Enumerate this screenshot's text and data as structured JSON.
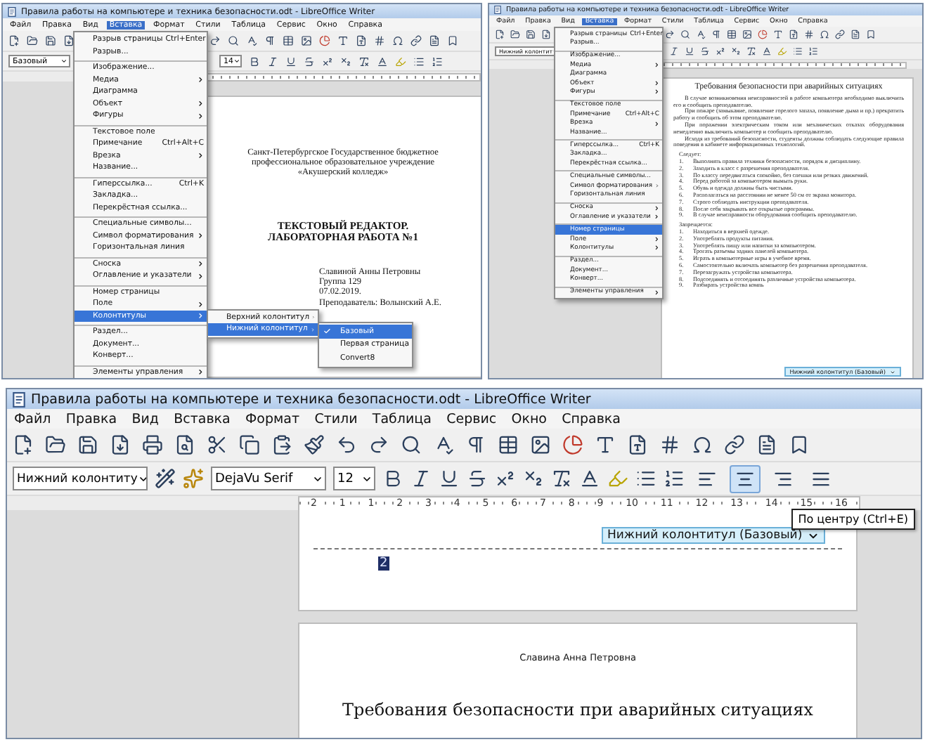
{
  "top_left": {
    "title": "Правила работы на компьютере и техника безопасности.odt - LibreOffice Writer",
    "menu": [
      {
        "label": "Файл",
        "selected": false
      },
      {
        "label": "Правка",
        "selected": false
      },
      {
        "label": "Вид",
        "selected": false
      },
      {
        "label": "Вставка",
        "selected": true
      },
      {
        "label": "Формат",
        "selected": false
      },
      {
        "label": "Стили",
        "selected": false
      },
      {
        "label": "Таблица",
        "selected": false
      },
      {
        "label": "Сервис",
        "selected": false
      },
      {
        "label": "Окно",
        "selected": false
      },
      {
        "label": "Справка",
        "selected": false
      }
    ],
    "style_box": "Базовый",
    "size_box": "14",
    "insert_menu": [
      {
        "label": "Разрыв страницы",
        "shortcut": "Ctrl+Enter",
        "submenu": false,
        "separator_before": false,
        "selected": false
      },
      {
        "label": "Разрыв...",
        "submenu": false,
        "separator_before": false,
        "selected": false
      },
      {
        "label": "Изображение...",
        "submenu": false,
        "separator_before": true,
        "selected": false
      },
      {
        "label": "Медиа",
        "submenu": true,
        "separator_before": false,
        "selected": false
      },
      {
        "label": "Диаграмма",
        "submenu": false,
        "separator_before": false,
        "selected": false
      },
      {
        "label": "Объект",
        "submenu": true,
        "separator_before": false,
        "selected": false
      },
      {
        "label": "Фигуры",
        "submenu": true,
        "separator_before": false,
        "selected": false
      },
      {
        "label": "Текстовое поле",
        "submenu": false,
        "separator_before": true,
        "selected": false
      },
      {
        "label": "Примечание",
        "shortcut": "Ctrl+Alt+C",
        "submenu": false,
        "separator_before": false,
        "selected": false
      },
      {
        "label": "Врезка",
        "submenu": true,
        "separator_before": false,
        "selected": false
      },
      {
        "label": "Название...",
        "submenu": false,
        "separator_before": false,
        "selected": false
      },
      {
        "label": "Гиперссылка...",
        "shortcut": "Ctrl+K",
        "submenu": false,
        "separator_before": true,
        "selected": false
      },
      {
        "label": "Закладка...",
        "submenu": false,
        "separator_before": false,
        "selected": false
      },
      {
        "label": "Перекрёстная ссылка...",
        "submenu": false,
        "separator_before": false,
        "selected": false
      },
      {
        "label": "Специальные символы...",
        "submenu": false,
        "separator_before": true,
        "selected": false
      },
      {
        "label": "Символ форматирования",
        "submenu": true,
        "separator_before": false,
        "selected": false
      },
      {
        "label": "Горизонтальная линия",
        "submenu": false,
        "separator_before": false,
        "selected": false
      },
      {
        "label": "Сноска",
        "submenu": true,
        "separator_before": true,
        "selected": false
      },
      {
        "label": "Оглавление и указатели",
        "submenu": true,
        "separator_before": false,
        "selected": false
      },
      {
        "label": "Номер страницы",
        "submenu": false,
        "separator_before": true,
        "selected": false
      },
      {
        "label": "Поле",
        "submenu": true,
        "separator_before": false,
        "selected": false
      },
      {
        "label": "Колонтитулы",
        "submenu": true,
        "separator_before": false,
        "selected": true
      },
      {
        "label": "Раздел...",
        "submenu": false,
        "separator_before": true,
        "selected": false
      },
      {
        "label": "Документ...",
        "submenu": false,
        "separator_before": false,
        "selected": false
      },
      {
        "label": "Конверт...",
        "submenu": false,
        "separator_before": false,
        "selected": false
      },
      {
        "label": "Элементы управления",
        "submenu": true,
        "separator_before": true,
        "selected": false
      }
    ],
    "headers_submenu": [
      {
        "label": "Верхний колонтитул",
        "selected": false
      },
      {
        "label": "Нижний колонтитул",
        "selected": true
      }
    ],
    "page_styles": [
      {
        "label": "Базовый",
        "checked": true,
        "selected": true
      },
      {
        "label": "Первая страница",
        "checked": false,
        "selected": false
      },
      {
        "label": "Convert8",
        "checked": false,
        "selected": false
      }
    ],
    "document": {
      "institution": [
        "Санкт-Петербургское Государственное бюджетное",
        "профессиональное  образовательное учреждение",
        "«Акушерский колледж»"
      ],
      "heading": [
        "ТЕКСТОВЫЙ РЕДАКТОР.",
        "ЛАБОРАТОРНАЯ РАБОТА №1"
      ],
      "author": [
        "Славиной Анны Петровны",
        "Группа 129",
        "07.02.2019.",
        "Преподаватель: Волынский А.Е."
      ]
    }
  },
  "top_right": {
    "title": "Правила работы на компьютере и техника безопасности.odt - LibreOffice Writer",
    "menu": [
      {
        "label": "Файл",
        "selected": false
      },
      {
        "label": "Правка",
        "selected": false
      },
      {
        "label": "Вид",
        "selected": false
      },
      {
        "label": "Вставка",
        "selected": true
      },
      {
        "label": "Формат",
        "selected": false
      },
      {
        "label": "Стили",
        "selected": false
      },
      {
        "label": "Таблица",
        "selected": false
      },
      {
        "label": "Сервис",
        "selected": false
      },
      {
        "label": "Окно",
        "selected": false
      },
      {
        "label": "Справка",
        "selected": false
      }
    ],
    "style_box": "Нижний колонтит",
    "insert_menu": [
      {
        "label": "Разрыв страницы",
        "shortcut": "Ctrl+Enter",
        "submenu": false,
        "separator_before": false,
        "selected": false
      },
      {
        "label": "Разрыв...",
        "submenu": false,
        "separator_before": false,
        "selected": false
      },
      {
        "label": "Изображение...",
        "submenu": false,
        "separator_before": true,
        "selected": false
      },
      {
        "label": "Медиа",
        "submenu": true,
        "separator_before": false,
        "selected": false
      },
      {
        "label": "Диаграмма",
        "submenu": false,
        "separator_before": false,
        "selected": false
      },
      {
        "label": "Объект",
        "submenu": true,
        "separator_before": false,
        "selected": false
      },
      {
        "label": "Фигуры",
        "submenu": true,
        "separator_before": false,
        "selected": false
      },
      {
        "label": "Текстовое поле",
        "submenu": false,
        "separator_before": true,
        "selected": false
      },
      {
        "label": "Примечание",
        "shortcut": "Ctrl+Alt+C",
        "submenu": false,
        "separator_before": false,
        "selected": false
      },
      {
        "label": "Врезка",
        "submenu": true,
        "separator_before": false,
        "selected": false
      },
      {
        "label": "Название...",
        "submenu": false,
        "separator_before": false,
        "selected": false
      },
      {
        "label": "Гиперссылка...",
        "shortcut": "Ctrl+K",
        "submenu": false,
        "separator_before": true,
        "selected": false
      },
      {
        "label": "Закладка...",
        "submenu": false,
        "separator_before": false,
        "selected": false
      },
      {
        "label": "Перекрёстная ссылка...",
        "submenu": false,
        "separator_before": false,
        "selected": false
      },
      {
        "label": "Специальные символы...",
        "submenu": false,
        "separator_before": true,
        "selected": false
      },
      {
        "label": "Символ форматирования",
        "submenu": true,
        "separator_before": false,
        "selected": false
      },
      {
        "label": "Горизонтальная линия",
        "submenu": false,
        "separator_before": false,
        "selected": false
      },
      {
        "label": "Сноска",
        "submenu": true,
        "separator_before": true,
        "selected": false
      },
      {
        "label": "Оглавление и указатели",
        "submenu": true,
        "separator_before": false,
        "selected": false
      },
      {
        "label": "Номер страницы",
        "submenu": false,
        "separator_before": true,
        "selected": true
      },
      {
        "label": "Поле",
        "submenu": true,
        "separator_before": false,
        "selected": false
      },
      {
        "label": "Колонтитулы",
        "submenu": true,
        "separator_before": false,
        "selected": false
      },
      {
        "label": "Раздел...",
        "submenu": false,
        "separator_before": true,
        "selected": false
      },
      {
        "label": "Документ...",
        "submenu": false,
        "separator_before": false,
        "selected": false
      },
      {
        "label": "Конверт...",
        "submenu": false,
        "separator_before": false,
        "selected": false
      },
      {
        "label": "Элементы управления",
        "submenu": true,
        "separator_before": true,
        "selected": false
      }
    ],
    "document": [
      {
        "kind": "title",
        "text": "Требования безопасности при аварийных ситуациях"
      },
      {
        "kind": "para",
        "text": "В случае возникновения неисправностей в работе компьютера необходимо выключить его и сообщить преподавателю."
      },
      {
        "kind": "para",
        "text": "При пожаре (замыкание, появление горелого запаха, появление дыма и пр.) прекратить работу и сообщить об этом преподавателю."
      },
      {
        "kind": "para",
        "text": "При поражении электрическим током или механических отказах оборудования немедленно выключить компьютер и сообщить преподавателю."
      },
      {
        "kind": "para",
        "text": "Исходя из требований безопасности, студенты должны соблюдать следующие правила поведения в кабинете информационных технологий."
      },
      {
        "kind": "label",
        "text": "Следует:"
      },
      {
        "kind": "item",
        "number": "1.",
        "text": "Выполнять правила техники безопасности, порядок и дисциплину."
      },
      {
        "kind": "item",
        "number": "2.",
        "text": "Заходить в класс с разрешения преподавателя."
      },
      {
        "kind": "item",
        "number": "3.",
        "text": "По классу передвигаться спокойно, без спешки или резких движений."
      },
      {
        "kind": "item",
        "number": "4.",
        "text": "Перед работой за компьютером вымыть руки."
      },
      {
        "kind": "item",
        "number": "5.",
        "text": "Обувь и одежда должны быть чистыми."
      },
      {
        "kind": "item",
        "number": "6.",
        "text": "Располагаться на расстоянии не менее 50 см от экрана монитора."
      },
      {
        "kind": "item",
        "number": "7.",
        "text": "Строго соблюдать инструкции преподавателя."
      },
      {
        "kind": "item",
        "number": "8.",
        "text": "После себя закрывать все открытые программы."
      },
      {
        "kind": "item",
        "number": "9.",
        "text": "В случае неисправности оборудования сообщить преподавателю."
      },
      {
        "kind": "label",
        "text": "Запрещается:"
      },
      {
        "kind": "item",
        "number": "1.",
        "text": "Находиться в верхней одежде."
      },
      {
        "kind": "item",
        "number": "2.",
        "text": "Употреблять продукты питания."
      },
      {
        "kind": "item",
        "number": "3.",
        "text": "Употреблять пищу или напитки за компьютером."
      },
      {
        "kind": "item",
        "number": "4.",
        "text": "Трогать разъемы задних панелей компьютера."
      },
      {
        "kind": "item",
        "number": "5.",
        "text": "Играть в компьютерные игры в учебное время."
      },
      {
        "kind": "item",
        "number": "6.",
        "text": "Самостоятельно включать компьютер без разрешения преподавателя."
      },
      {
        "kind": "item",
        "number": "7.",
        "text": "Перезагружать устройства компьютера."
      },
      {
        "kind": "item",
        "number": "8.",
        "text": "Подсоединять и отсоединять различные устройства компьютера."
      },
      {
        "kind": "item",
        "number": "9.",
        "text": "Разбирать устройства компь"
      }
    ],
    "footer_tag": "Нижний колонтитул (Базовый)"
  },
  "bottom": {
    "title": "Правила работы на компьютере и техника безопасности.odt - LibreOffice Writer",
    "menu": [
      {
        "label": "Файл",
        "selected": false
      },
      {
        "label": "Правка",
        "selected": false
      },
      {
        "label": "Вид",
        "selected": false
      },
      {
        "label": "Вставка",
        "selected": false
      },
      {
        "label": "Формат",
        "selected": false
      },
      {
        "label": "Стили",
        "selected": false
      },
      {
        "label": "Таблица",
        "selected": false
      },
      {
        "label": "Сервис",
        "selected": false
      },
      {
        "label": "Окно",
        "selected": false
      },
      {
        "label": "Справка",
        "selected": false
      }
    ],
    "style_box": "Нижний колонтиту",
    "font_box": "DejaVu Serif",
    "size_box": "12",
    "alignment": [
      {
        "kind": "left",
        "selected": false
      },
      {
        "kind": "center",
        "selected": true
      },
      {
        "kind": "right",
        "selected": false
      },
      {
        "kind": "justify",
        "selected": false
      }
    ],
    "tooltip": "По центру (Ctrl+E)",
    "ruler": [
      "2",
      "1",
      "1",
      "2",
      "3",
      "4",
      "5",
      "6",
      "7",
      "8",
      "9",
      "10",
      "11",
      "12",
      "13",
      "14",
      "15",
      "16"
    ],
    "footer_tag": "Нижний колонтитул (Базовый)",
    "page_number": {
      "text": "2",
      "selected": true
    },
    "next_page": {
      "header": "Славина Анна Петровна",
      "heading": "Требования безопасности при аварийных ситуациях"
    }
  }
}
